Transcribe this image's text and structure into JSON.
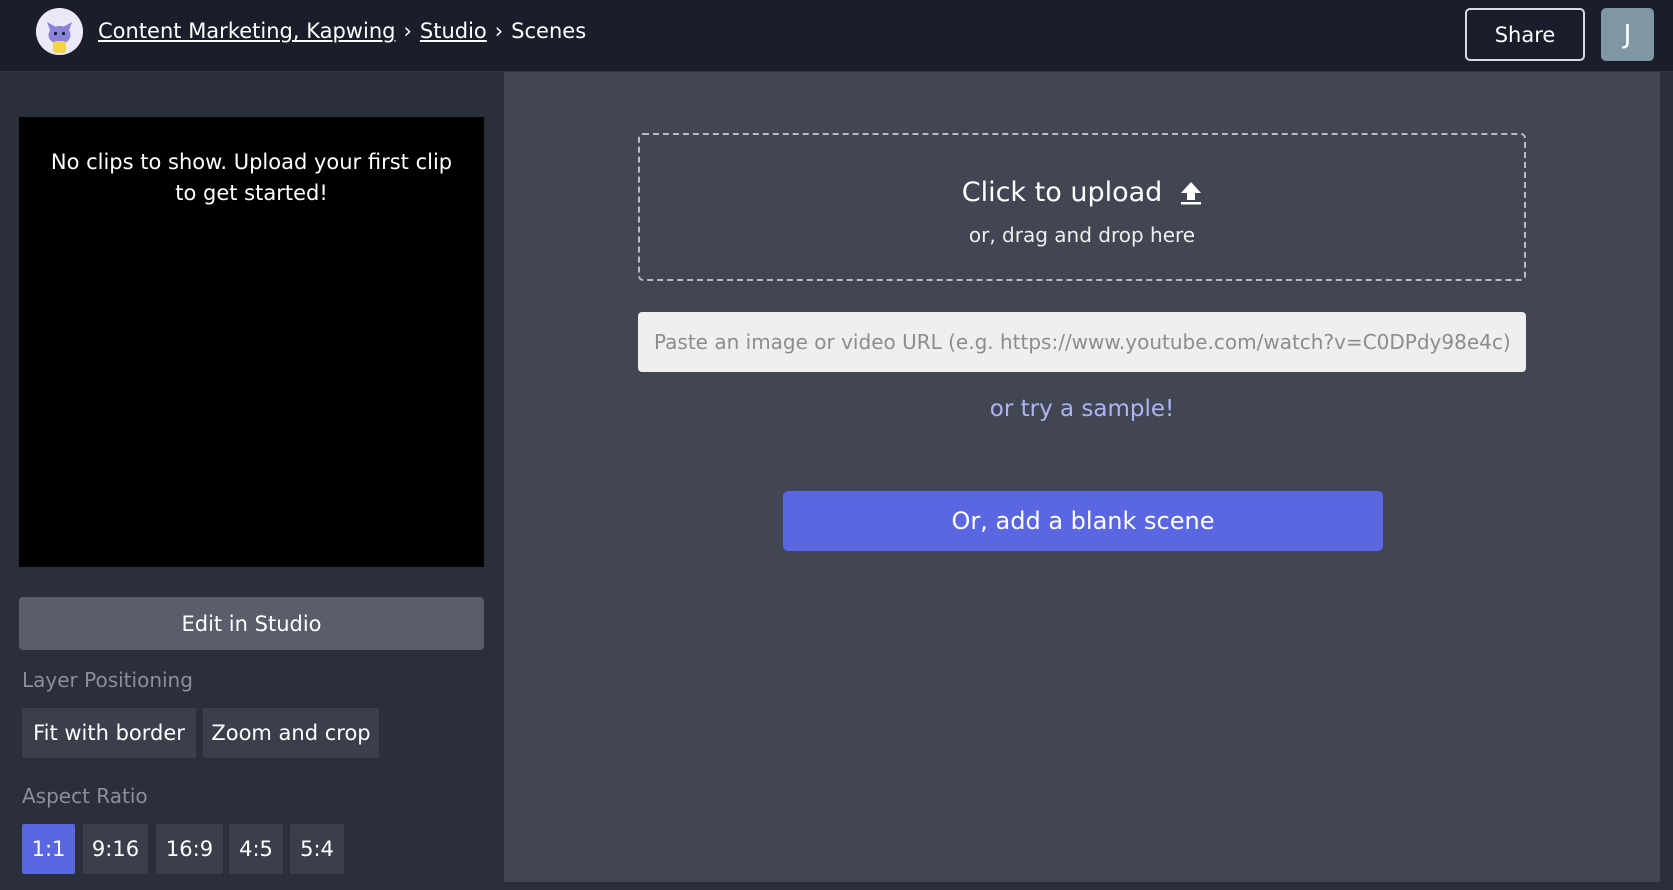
{
  "header": {
    "breadcrumb": [
      {
        "label": "Content Marketing, Kapwing",
        "link": true
      },
      {
        "label": "Studio",
        "link": true
      },
      {
        "label": "Scenes",
        "link": false
      }
    ],
    "separator": "›",
    "share_label": "Share",
    "avatar_initial": "J",
    "logo_icon": "kapwing-cat-logo-icon"
  },
  "sidebar": {
    "preview_message": "No clips to show. Upload your first clip to get started!",
    "edit_label": "Edit in Studio",
    "layer_positioning": {
      "label": "Layer Positioning",
      "options": [
        "Fit with border",
        "Zoom and crop"
      ]
    },
    "aspect_ratio": {
      "label": "Aspect Ratio",
      "options": [
        "1:1",
        "9:16",
        "16:9",
        "4:5",
        "5:4"
      ],
      "selected": "1:1"
    }
  },
  "main": {
    "upload_title": "Click to upload",
    "upload_sub": "or, drag and drop here",
    "upload_icon": "upload-arrow-icon",
    "url_placeholder": "Paste an image or video URL (e.g. https://www.youtube.com/watch?v=C0DPdy98e4c)",
    "url_value": "",
    "sample_label": "or try a sample!",
    "blank_scene_label": "Or, add a blank scene"
  },
  "colors": {
    "accent": "#5a67e0",
    "header_bg": "#1a1e2b",
    "sidebar_bg": "#2b2f3b",
    "main_bg": "#424652",
    "link": "#aeb4f2"
  }
}
